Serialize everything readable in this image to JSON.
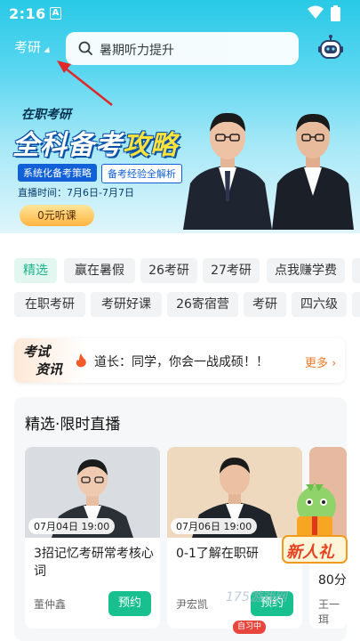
{
  "status": {
    "time": "2:16",
    "notif": "A"
  },
  "header": {
    "exam": "考研",
    "search_placeholder": "暑期听力提升"
  },
  "banner": {
    "tag": "在职考研",
    "title_a": "全科备考",
    "title_b": "攻略",
    "chip1": "系统化备考策略",
    "chip2": "备考经验全解析",
    "date": "直播时间：7月6日-7月7日",
    "button": "0元听课"
  },
  "tags_row1": [
    "精选",
    "赢在暑假",
    "26考研",
    "27考研",
    "点我赚学费"
  ],
  "tags_row2": [
    "在职考研",
    "考研好课",
    "26寄宿营",
    "考研",
    "四六级"
  ],
  "news": {
    "logo_line1": "考试",
    "logo_line2": "资讯",
    "text": "道长：同学，你会一战成硕！！",
    "more": "更多 ›"
  },
  "live": {
    "title": "精选·限时直播",
    "cards": [
      {
        "time": "07月04日 19:00",
        "title": "3招记忆考研常考核心词",
        "teacher": "董仲鑫",
        "button": "预约"
      },
      {
        "time": "07月06日 19:00",
        "title": "0-1了解在职研",
        "teacher": "尹宏凯",
        "button": "预约"
      },
      {
        "time": "",
        "title": "80分",
        "teacher": "王一珥",
        "button": ""
      }
    ]
  },
  "overlay": {
    "gift": "新人礼",
    "study": "自习中",
    "watermark": "175游戏网"
  },
  "colors": {
    "accent": "#19c08f",
    "hero": "#29c9e6"
  }
}
